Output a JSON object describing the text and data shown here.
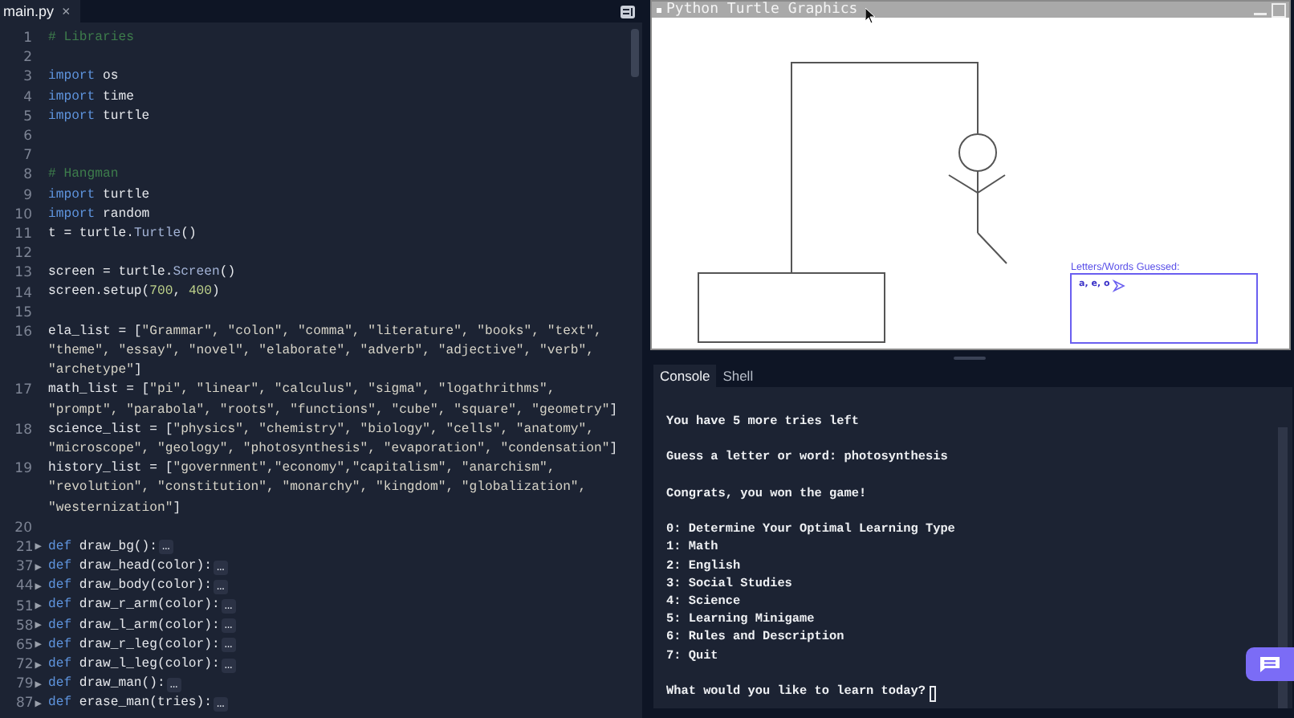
{
  "editor": {
    "tab": {
      "label": "main.py",
      "close": "×",
      "selected": true
    },
    "lines": [
      {
        "number": "1",
        "segments": [
          {
            "text": "# Libraries",
            "kind": "comment"
          }
        ]
      },
      {
        "number": "2"
      },
      {
        "number": "3",
        "segments": [
          {
            "text": "import",
            "kind": "keyword"
          },
          {
            "text": " os",
            "kind": "plain"
          }
        ]
      },
      {
        "number": "4",
        "segments": [
          {
            "text": "import",
            "kind": "keyword"
          },
          {
            "text": " time",
            "kind": "plain"
          }
        ]
      },
      {
        "number": "5",
        "segments": [
          {
            "text": "import",
            "kind": "keyword"
          },
          {
            "text": " turtle",
            "kind": "plain"
          }
        ]
      },
      {
        "number": "6"
      },
      {
        "number": "7"
      },
      {
        "number": "8",
        "segments": [
          {
            "text": "# Hangman",
            "kind": "comment"
          }
        ]
      },
      {
        "number": "9",
        "segments": [
          {
            "text": "import",
            "kind": "keyword"
          },
          {
            "text": " turtle",
            "kind": "plain"
          }
        ]
      },
      {
        "number": "10",
        "segments": [
          {
            "text": "import",
            "kind": "keyword"
          },
          {
            "text": " random",
            "kind": "plain"
          }
        ]
      },
      {
        "number": "11",
        "segments": [
          {
            "text": "t = turtle.",
            "kind": "plain"
          },
          {
            "text": "Turtle",
            "kind": "class"
          },
          {
            "text": "()",
            "kind": "plain"
          }
        ]
      },
      {
        "number": "12"
      },
      {
        "number": "13",
        "segments": [
          {
            "text": "screen = turtle.",
            "kind": "plain"
          },
          {
            "text": "Screen",
            "kind": "class"
          },
          {
            "text": "()",
            "kind": "plain"
          }
        ]
      },
      {
        "number": "14",
        "segments": [
          {
            "text": "screen.setup(",
            "kind": "plain"
          },
          {
            "text": "700",
            "kind": "number"
          },
          {
            "text": ", ",
            "kind": "plain"
          },
          {
            "text": "400",
            "kind": "number"
          },
          {
            "text": ")",
            "kind": "plain"
          }
        ]
      },
      {
        "number": "15"
      },
      {
        "number": "16",
        "segments": [
          {
            "text": "ela_list = [",
            "kind": "plain"
          },
          {
            "text": "\"Grammar\", \"colon\", \"comma\", \"literature\", \"books\", \"text\",",
            "kind": "string"
          }
        ]
      },
      {
        "segments": [
          {
            "text": "\"theme\", \"essay\", \"novel\", \"elaborate\", \"adverb\", \"adjective\", \"verb\",",
            "kind": "string"
          }
        ]
      },
      {
        "segments": [
          {
            "text": "\"archetype\"",
            "kind": "string"
          },
          {
            "text": "]",
            "kind": "plain"
          }
        ]
      },
      {
        "number": "17",
        "segments": [
          {
            "text": "math_list = [",
            "kind": "plain"
          },
          {
            "text": "\"pi\", \"linear\", \"calculus\", \"sigma\", \"logathrithms\",",
            "kind": "string"
          }
        ]
      },
      {
        "segments": [
          {
            "text": "\"prompt\", \"parabola\", \"roots\", \"functions\", \"cube\", \"square\", \"geometry\"",
            "kind": "string"
          },
          {
            "text": "]",
            "kind": "plain"
          }
        ]
      },
      {
        "number": "18",
        "segments": [
          {
            "text": "science_list = [",
            "kind": "plain"
          },
          {
            "text": "\"physics\", \"chemistry\", \"biology\", \"cells\", \"anatomy\",",
            "kind": "string"
          }
        ]
      },
      {
        "segments": [
          {
            "text": "\"microscope\", \"geology\", \"photosynthesis\", \"evaporation\", \"condensation\"",
            "kind": "string"
          },
          {
            "text": "]",
            "kind": "plain"
          }
        ]
      },
      {
        "number": "19",
        "segments": [
          {
            "text": "history_list = [",
            "kind": "plain"
          },
          {
            "text": "\"government\",\"economy\",\"capitalism\", \"anarchism\",",
            "kind": "string"
          }
        ]
      },
      {
        "segments": [
          {
            "text": "\"revolution\", \"constitution\", \"monarchy\", \"kingdom\", \"globalization\",",
            "kind": "string"
          }
        ]
      },
      {
        "segments": [
          {
            "text": "\"westernization\"",
            "kind": "string"
          },
          {
            "text": "]",
            "kind": "plain"
          }
        ]
      },
      {
        "number": "20"
      },
      {
        "number": "21",
        "fold": "▶",
        "folded": "…",
        "segments": [
          {
            "text": "def",
            "kind": "keyword"
          },
          {
            "text": " draw_bg():",
            "kind": "plain"
          }
        ]
      },
      {
        "number": "37",
        "fold": "▶",
        "folded": "…",
        "segments": [
          {
            "text": "def",
            "kind": "keyword"
          },
          {
            "text": " draw_head(color):",
            "kind": "plain"
          }
        ]
      },
      {
        "number": "44",
        "fold": "▶",
        "folded": "…",
        "segments": [
          {
            "text": "def",
            "kind": "keyword"
          },
          {
            "text": " draw_body(color):",
            "kind": "plain"
          }
        ]
      },
      {
        "number": "51",
        "fold": "▶",
        "folded": "…",
        "segments": [
          {
            "text": "def",
            "kind": "keyword"
          },
          {
            "text": " draw_r_arm(color):",
            "kind": "plain"
          }
        ]
      },
      {
        "number": "58",
        "fold": "▶",
        "folded": "…",
        "segments": [
          {
            "text": "def",
            "kind": "keyword"
          },
          {
            "text": " draw_l_arm(color):",
            "kind": "plain"
          }
        ]
      },
      {
        "number": "65",
        "fold": "▶",
        "folded": "…",
        "segments": [
          {
            "text": "def",
            "kind": "keyword"
          },
          {
            "text": " draw_r_leg(color):",
            "kind": "plain"
          }
        ]
      },
      {
        "number": "72",
        "fold": "▶",
        "folded": "…",
        "segments": [
          {
            "text": "def",
            "kind": "keyword"
          },
          {
            "text": " draw_l_leg(color):",
            "kind": "plain"
          }
        ]
      },
      {
        "number": "79",
        "fold": "▶",
        "folded": "…",
        "segments": [
          {
            "text": "def",
            "kind": "keyword"
          },
          {
            "text": " draw_man():",
            "kind": "plain"
          }
        ]
      },
      {
        "number": "87",
        "fold": "▶",
        "folded": "…",
        "segments": [
          {
            "text": "def",
            "kind": "keyword"
          },
          {
            "text": " erase_man(tries):",
            "kind": "plain"
          }
        ]
      }
    ]
  },
  "turtle_window": {
    "title": "Python Turtle Graphics",
    "guessed_label": "Letters/Words Guessed:",
    "guessed_letters": "a, e, o"
  },
  "console": {
    "tabs": [
      {
        "label": "Console",
        "selected": true
      },
      {
        "label": "Shell",
        "selected": false
      }
    ],
    "blocks": [
      [
        "You have 5 more tries left"
      ],
      [
        "Guess a letter or word: photosynthesis"
      ],
      [
        "Congrats, you won the game!"
      ],
      [
        "0: Determine Your Optimal Learning Type",
        "1: Math",
        "2: English",
        "3: Social Studies",
        "4: Science",
        "5: Learning Minigame",
        "6: Rules and Description",
        "7: Quit"
      ]
    ],
    "prompt": "What would you like to learn today?"
  }
}
